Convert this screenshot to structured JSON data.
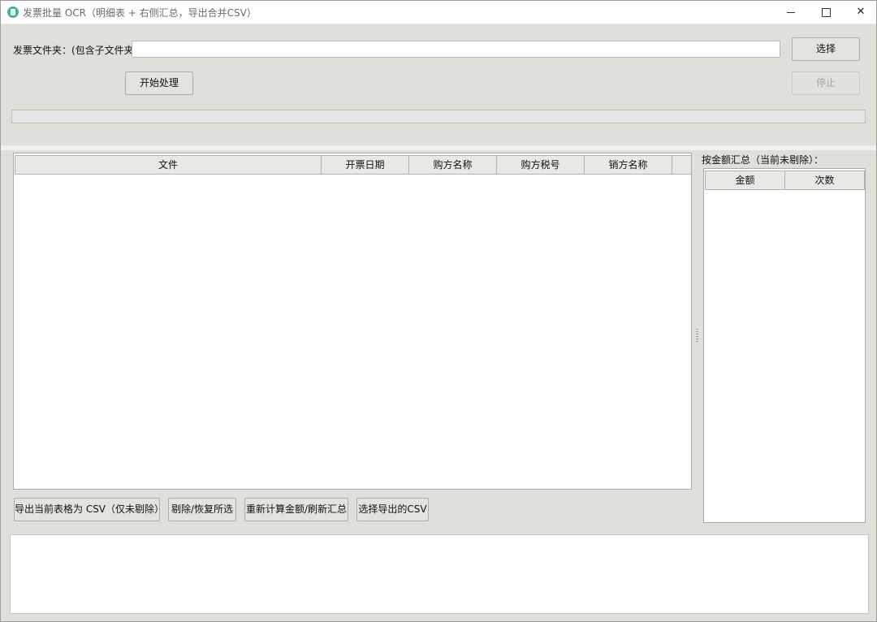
{
  "window": {
    "title": "发票批量 OCR（明细表 + 右侧汇总，导出合并CSV）",
    "controls": {
      "minimize": "─",
      "maximize": "☐",
      "close": "✕"
    }
  },
  "folder": {
    "label": "发票文件夹：(包含子文件夹)",
    "value": "",
    "choose_label": "选择"
  },
  "actions": {
    "start_label": "开始处理",
    "stop_label": "停止"
  },
  "progress": {
    "value": 0
  },
  "table": {
    "columns": [
      "文件",
      "开票日期",
      "购方名称",
      "购方税号",
      "销方名称"
    ],
    "rows": []
  },
  "bottom_buttons": {
    "export_current": "导出当前表格为 CSV（仅未剔除）",
    "toggle_exclude": "剔除/恢复所选",
    "recalculate": "重新计算金额/刷新汇总",
    "choose_export": "选择导出的CSV"
  },
  "summary": {
    "title": "按金额汇总（当前未剔除）：",
    "columns": [
      "金额",
      "次数"
    ],
    "rows": []
  },
  "log": {
    "text": ""
  }
}
